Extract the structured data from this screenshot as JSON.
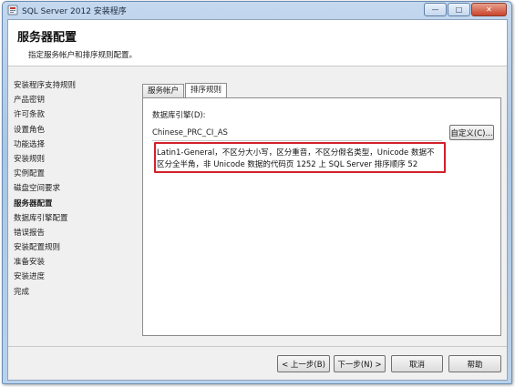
{
  "window": {
    "title": "SQL Server 2012 安装程序",
    "caption_buttons": [
      "minimize",
      "maximize",
      "close"
    ]
  },
  "header": {
    "title": "服务器配置",
    "subtitle": "指定服务帐户和排序规则配置。"
  },
  "sidebar": {
    "items": [
      {
        "label": "安装程序支持规则",
        "active": false
      },
      {
        "label": "产品密钥",
        "active": false
      },
      {
        "label": "许可条款",
        "active": false
      },
      {
        "label": "设置角色",
        "active": false
      },
      {
        "label": "功能选择",
        "active": false
      },
      {
        "label": "安装规则",
        "active": false
      },
      {
        "label": "实例配置",
        "active": false
      },
      {
        "label": "磁盘空间要求",
        "active": false
      },
      {
        "label": "服务器配置",
        "active": true
      },
      {
        "label": "数据库引擎配置",
        "active": false
      },
      {
        "label": "错误报告",
        "active": false
      },
      {
        "label": "安装配置规则",
        "active": false
      },
      {
        "label": "准备安装",
        "active": false
      },
      {
        "label": "安装进度",
        "active": false
      },
      {
        "label": "完成",
        "active": false
      }
    ]
  },
  "tabs": [
    {
      "label": "服务帐户",
      "active": false
    },
    {
      "label": "排序规则",
      "active": true
    }
  ],
  "collation": {
    "label": "数据库引擎(D):",
    "value": "Chinese_PRC_CI_AS",
    "customize_label": "自定义(C)...",
    "description": "Latin1-General，不区分大小写，区分重音，不区分假名类型，Unicode 数据不区分全半角，非 Unicode 数据的代码页 1252 上 SQL Server 排序顺序 52"
  },
  "footer": {
    "back_label": "< 上一步(B)",
    "next_label": "下一步(N) >",
    "cancel_label": "取消",
    "help_label": "帮助"
  },
  "colors": {
    "highlight_border": "#d3202a",
    "titlebar": "#b9d2ec"
  }
}
